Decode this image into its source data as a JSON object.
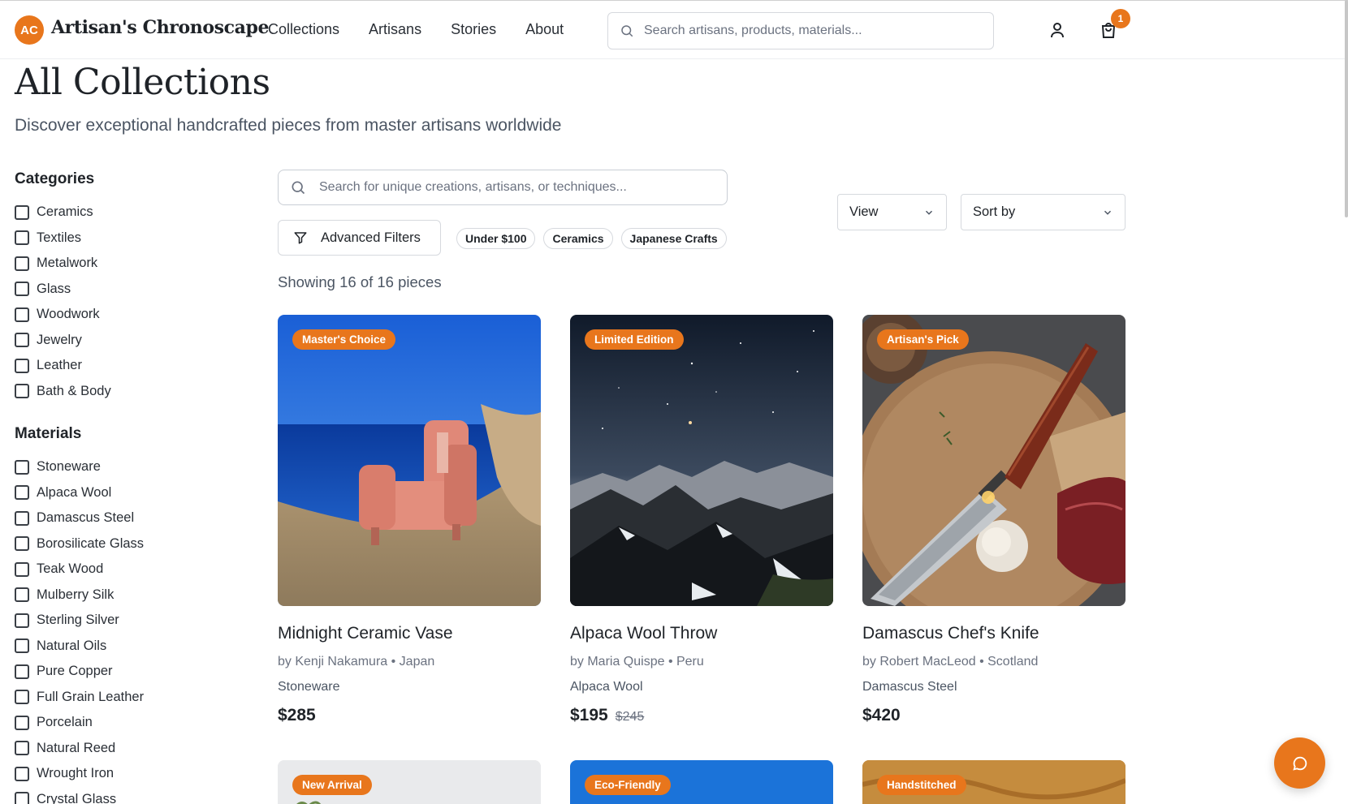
{
  "brand": {
    "badge": "AC",
    "name": "Artisan's Chronoscape"
  },
  "nav": [
    "Collections",
    "Artisans",
    "Stories",
    "About"
  ],
  "header_search": {
    "placeholder": "Search artisans, products, materials..."
  },
  "cart": {
    "count": "1"
  },
  "page": {
    "title": "All Collections",
    "subtitle": "Discover exceptional handcrafted pieces from master artisans worldwide"
  },
  "sidebar": {
    "categories_heading": "Categories",
    "categories": [
      "Ceramics",
      "Textiles",
      "Metalwork",
      "Glass",
      "Woodwork",
      "Jewelry",
      "Leather",
      "Bath & Body"
    ],
    "materials_heading": "Materials",
    "materials": [
      "Stoneware",
      "Alpaca Wool",
      "Damascus Steel",
      "Borosilicate Glass",
      "Teak Wood",
      "Mulberry Silk",
      "Sterling Silver",
      "Natural Oils",
      "Pure Copper",
      "Full Grain Leather",
      "Porcelain",
      "Natural Reed",
      "Wrought Iron",
      "Crystal Glass"
    ]
  },
  "toolbar": {
    "search_placeholder": "Search for unique creations, artisans, or techniques...",
    "advanced_filters": "Advanced Filters",
    "chips": [
      "Under $100",
      "Ceramics",
      "Japanese Crafts"
    ],
    "view_label": "View",
    "sort_label": "Sort by",
    "showing": "Showing 16 of 16 pieces"
  },
  "products": [
    {
      "badge": "Master's Choice",
      "title": "Midnight Ceramic Vase",
      "by": "by Kenji Nakamura • Japan",
      "material": "Stoneware",
      "price": "$285",
      "old_price": ""
    },
    {
      "badge": "Limited Edition",
      "title": "Alpaca Wool Throw",
      "by": "by Maria Quispe • Peru",
      "material": "Alpaca Wool",
      "price": "$195",
      "old_price": "$245"
    },
    {
      "badge": "Artisan's Pick",
      "title": "Damascus Chef's Knife",
      "by": "by Robert MacLeod • Scotland",
      "material": "Damascus Steel",
      "price": "$420",
      "old_price": ""
    }
  ],
  "products_row2": [
    {
      "badge": "New Arrival"
    },
    {
      "badge": "Eco-Friendly"
    },
    {
      "badge": "Handstitched"
    }
  ],
  "colors": {
    "accent": "#e8761c",
    "text": "#1f2328",
    "muted": "#6b7280"
  },
  "icons": [
    "search-icon",
    "user-icon",
    "cart-icon",
    "filter-icon",
    "chevron-down-icon",
    "chat-icon"
  ]
}
